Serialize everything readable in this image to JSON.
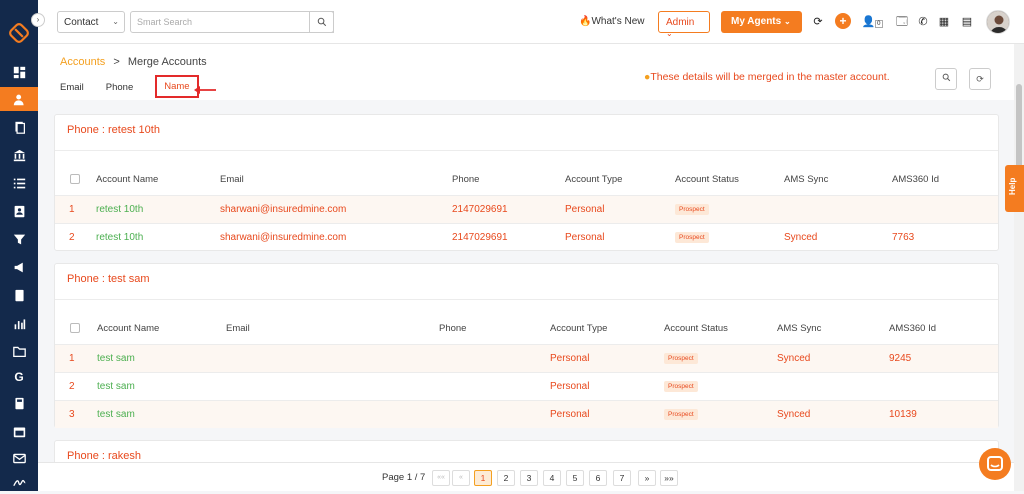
{
  "topbar": {
    "contact_select": "Contact",
    "search_placeholder": "Smart Search",
    "whats_new": "What's New",
    "admin_select": "Admin",
    "my_agents": "My Agents",
    "notif_count": "0"
  },
  "breadcrumb": {
    "parent": "Accounts",
    "separator": ">",
    "current": "Merge Accounts"
  },
  "tabs": [
    {
      "label": "Email"
    },
    {
      "label": "Phone"
    },
    {
      "label": "Name"
    }
  ],
  "merge_note": "These details will be merged in the master account.",
  "columns": [
    "Account Name",
    "Email",
    "Phone",
    "Account Type",
    "Account Status",
    "AMS Sync",
    "AMS360 Id"
  ],
  "groups": [
    {
      "title": "Phone : retest 10th",
      "rows": [
        {
          "num": "1",
          "name": "retest 10th",
          "email": "sharwani@insuredmine.com",
          "phone": "2147029691",
          "type": "Personal",
          "status": "Prospect",
          "sync": "",
          "ams_id": ""
        },
        {
          "num": "2",
          "name": "retest 10th",
          "email": "sharwani@insuredmine.com",
          "phone": "2147029691",
          "type": "Personal",
          "status": "Prospect",
          "sync": "Synced",
          "ams_id": "7763"
        }
      ]
    },
    {
      "title": "Phone : test sam",
      "rows": [
        {
          "num": "1",
          "name": "test sam",
          "email": "",
          "phone": "",
          "type": "Personal",
          "status": "Prospect",
          "sync": "Synced",
          "ams_id": "9245"
        },
        {
          "num": "2",
          "name": "test sam",
          "email": "",
          "phone": "",
          "type": "Personal",
          "status": "Prospect",
          "sync": "",
          "ams_id": ""
        },
        {
          "num": "3",
          "name": "test sam",
          "email": "",
          "phone": "",
          "type": "Personal",
          "status": "Prospect",
          "sync": "Synced",
          "ams_id": "10139"
        }
      ]
    },
    {
      "title": "Phone : rakesh",
      "rows": []
    }
  ],
  "pager": {
    "label": "Page 1 / 7",
    "first": "««",
    "prev": "«",
    "pages": [
      "1",
      "2",
      "3",
      "4",
      "5",
      "6",
      "7"
    ],
    "next": "»",
    "last": "»»"
  },
  "help_label": "Help",
  "colors": {
    "accent": "#f47c20",
    "link": "#e8491d",
    "name_green": "#4caf50",
    "sidebar": "#13294b"
  }
}
